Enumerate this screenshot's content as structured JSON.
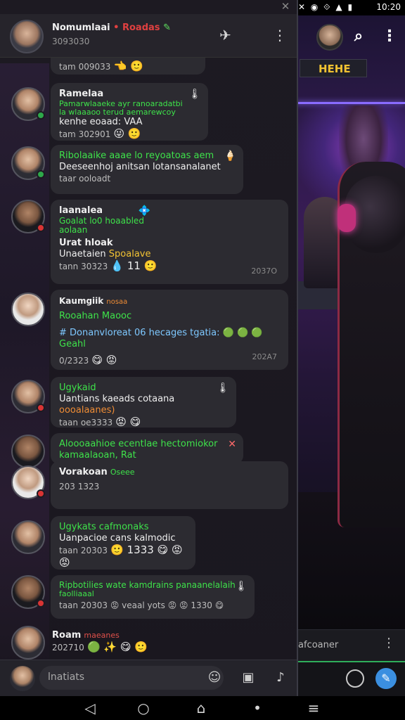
{
  "status_bar": {
    "icons": "✕ ◉ ⟐ ▲ ▮",
    "time": "10:20"
  },
  "chat_header": {
    "title": "Nomumlaai",
    "status_text": "• Roadas",
    "subtitle": "3093030",
    "close_glyph": "✕"
  },
  "messages": [
    {
      "partial": true,
      "time": "tam 009033",
      "emoji": "👈 🙂"
    },
    {
      "name": "Ramelaa",
      "lines": [
        "Pamarwlaaeke ayr ranoaradatbi",
        "la wlaaaoo terud aemarewcoy"
      ],
      "body": "kenhe eoaad: VAA",
      "time": "tam 302901",
      "emoji": "😜 🙂",
      "pin": "🌡"
    },
    {
      "lines": [
        "Ribolaaike aaae lo reyoatoas aem"
      ],
      "body": "Deeseenhoj anitsan lotansanalanet",
      "time": "taar ooloadt",
      "pin": "🍦"
    },
    {
      "name": "laanalea",
      "lines": [
        "Goalat lo0 hoaabled",
        "aolaan"
      ],
      "body": "Urat hloak",
      "body2": "Unaetaien",
      "yellow": "Spoalave",
      "time": "tann 30323",
      "emoji": "💧 11 🙂",
      "seen": "2037O",
      "pin": "💠"
    },
    {
      "name": "Kaumgiik",
      "namex": "nosaa",
      "lines": [
        "Rooahan Maooc"
      ],
      "body": "# Donanvloreat 06 hecages tgatia:",
      "body_line2": "Geahl",
      "time": "0/2323",
      "emoji": "😋 😡",
      "seen": "202A7",
      "green_emoji": "🟢 🟢 🟢"
    },
    {
      "lines": [
        "Ugykaid"
      ],
      "body": "Uantians kaeads cotaana",
      "orange": "oooalaanes)",
      "time": "taan oe3333",
      "emoji": "😡 😋",
      "pin": "🌡"
    },
    {
      "lines": [
        "Aloooaahioe ecentlae hectomiokor",
        "kamaalaoan, Rat"
      ],
      "time": "",
      "pin": "✕"
    },
    {
      "name": "Vorakoan",
      "green_tag": "Oseee",
      "time": "203 1323"
    },
    {
      "lines": [
        "Ugykats cafmonaks"
      ],
      "body": "Uanpacioe cans kalmodic",
      "time": "taan 20303",
      "emoji": "🙂 1333 😋 😡 😡"
    },
    {
      "lines": [
        "Ripbotilies wate kamdrains panaanelalaih",
        "faolliaaal"
      ],
      "body": "taan 20303 😡 veaal yots 😡 😡 1330 😋",
      "pin": "🌡"
    },
    {
      "name": "Roam",
      "namex": "maeanes",
      "time": "202710",
      "emoji": "🟢 ✨ 😋 🙂"
    }
  ],
  "composer": {
    "placeholder": "lnatiats"
  },
  "right_panel": {
    "poster_text": "HEHE",
    "input_text": "afcoaner",
    "search_icon": "search-icon",
    "more_icon": "more-vertical-icon"
  },
  "nav": [
    "◁",
    "○",
    "⌂",
    "•",
    "≡"
  ],
  "colors": {
    "green": "#3ee24a",
    "yellow": "#f3c334",
    "orange": "#f08d35",
    "accent": "#3b8fe0"
  }
}
